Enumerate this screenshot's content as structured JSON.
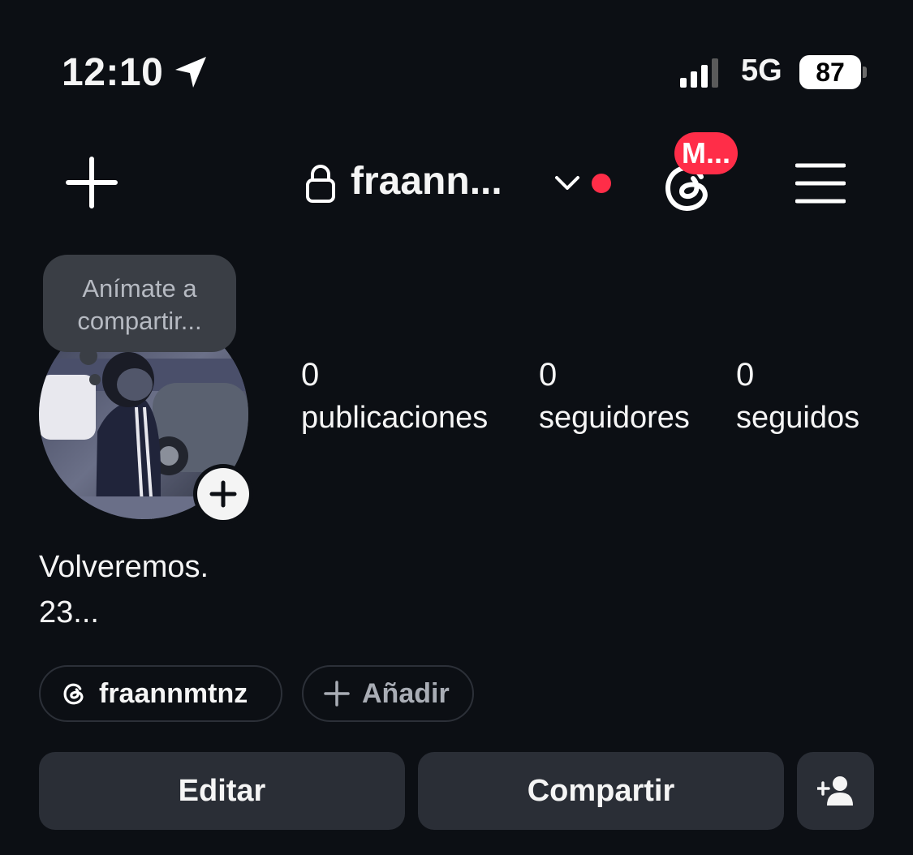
{
  "status_bar": {
    "time": "12:10",
    "network": "5G",
    "battery": "87"
  },
  "header": {
    "username": "fraann...",
    "notification_badge": "M...",
    "accent_color": "#ff2d48"
  },
  "tooltip": {
    "line1": "Anímate a",
    "line2": "compartir..."
  },
  "stats": [
    {
      "value": "0",
      "label": "publicaciones"
    },
    {
      "value": "0",
      "label": "seguidores"
    },
    {
      "value": "0",
      "label": "seguidos"
    }
  ],
  "bio": {
    "line1": "Volveremos.",
    "line2": "23..."
  },
  "chips": {
    "threads_handle": "fraannmtnz",
    "add_label": "Añadir"
  },
  "buttons": {
    "edit": "Editar",
    "share": "Compartir"
  },
  "icons": [
    "location-arrow-icon",
    "signal-icon",
    "battery-icon",
    "plus-icon",
    "lock-icon",
    "chevron-down-icon",
    "threads-icon",
    "menu-icon",
    "add-person-icon"
  ]
}
